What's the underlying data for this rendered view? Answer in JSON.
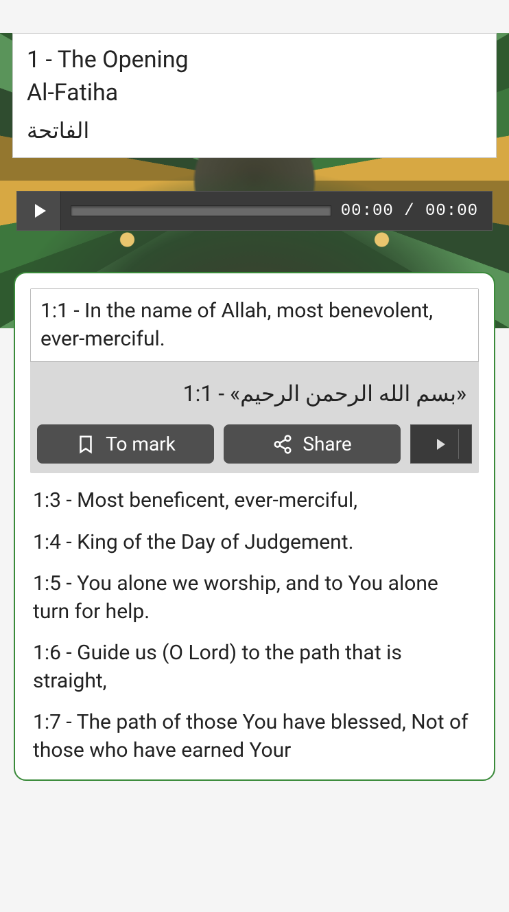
{
  "header": {
    "number_title": "1 - The Opening",
    "translit": "Al-Fatiha",
    "arabic": "الفاتحة"
  },
  "player": {
    "time_display": "00:00 / 00:00"
  },
  "selected": {
    "en": "1:1 - In the name of Allah, most benevolent, ever-merciful.",
    "ar": "«بسم الله الرحمن الرحيم» - 1:1",
    "mark_label": "To mark",
    "share_label": "Share"
  },
  "verses": [
    "1:3 - Most beneficent, ever-merciful,",
    "1:4 - King of the Day of Judgement.",
    "1:5 - You alone we worship, and to You alone turn for help.",
    "1:6 - Guide us (O Lord) to the path that is straight,",
    "1:7 - The path of those You have blessed, Not of those who have earned Your"
  ]
}
